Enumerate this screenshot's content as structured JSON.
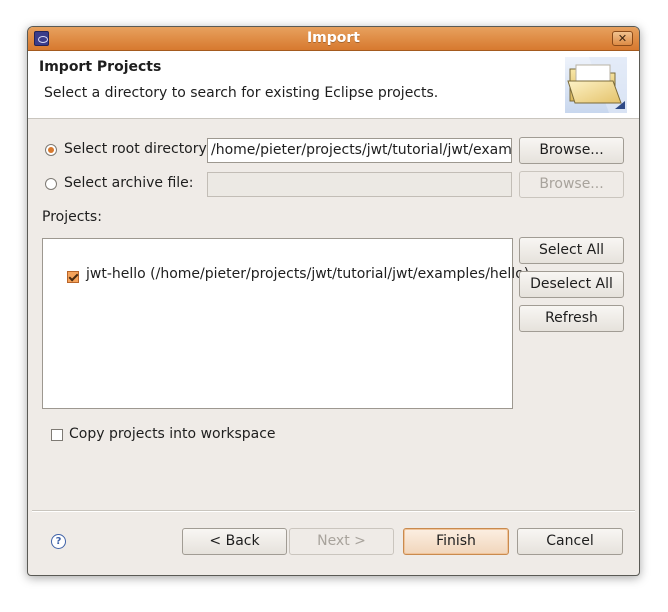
{
  "window": {
    "title": "Import",
    "close_glyph": "✕"
  },
  "header": {
    "title": "Import Projects",
    "description": "Select a directory to search for existing Eclipse projects."
  },
  "source": {
    "root_dir_label": "Select root directory:",
    "root_dir_value": "/home/pieter/projects/jwt/tutorial/jwt/examples/hello",
    "archive_label": "Select archive file:",
    "archive_value": "",
    "browse_label": "Browse...",
    "selected": "root_directory"
  },
  "projects": {
    "label": "Projects:",
    "items": [
      {
        "label": "jwt-hello (/home/pieter/projects/jwt/tutorial/jwt/examples/hello)",
        "checked": true
      }
    ],
    "select_all": "Select All",
    "deselect_all": "Deselect All",
    "refresh": "Refresh"
  },
  "options": {
    "copy_label": "Copy projects into workspace",
    "copy_checked": false
  },
  "footer": {
    "help_glyph": "?",
    "back": "< Back",
    "next": "Next >",
    "finish": "Finish",
    "cancel": "Cancel"
  },
  "colors": {
    "titlebar": "#d7792f",
    "dialog_bg": "#efebe7",
    "accent": "#f5a35b"
  },
  "icons": {
    "app": "eclipse-app-icon",
    "header": "folder-open-icon",
    "help": "help-icon",
    "close": "close-icon"
  }
}
